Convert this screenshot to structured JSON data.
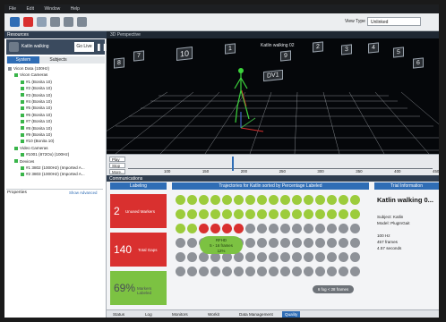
{
  "menu": [
    "File",
    "Edit",
    "Window",
    "Help"
  ],
  "toolbar": {
    "view_type_label": "View Type",
    "view_type_value": "Unlinked"
  },
  "left_panel": {
    "header": "Resources",
    "session_name": "Katlin walking",
    "go_live": "Go Live",
    "tabs": [
      "System",
      "Subjects"
    ],
    "tree": [
      {
        "label": "Vicon Data (100Hz)",
        "indent": 0,
        "color": "grey"
      },
      {
        "label": "Vicon Cameras",
        "indent": 1,
        "color": "green"
      },
      {
        "label": "#1 (Bonita 10)",
        "indent": 2,
        "color": "green"
      },
      {
        "label": "#2 (Bonita 10)",
        "indent": 2,
        "color": "green"
      },
      {
        "label": "#3 (Bonita 10)",
        "indent": 2,
        "color": "green"
      },
      {
        "label": "#4 (Bonita 10)",
        "indent": 2,
        "color": "green"
      },
      {
        "label": "#5 (Bonita 10)",
        "indent": 2,
        "color": "green"
      },
      {
        "label": "#6 (Bonita 10)",
        "indent": 2,
        "color": "green"
      },
      {
        "label": "#7 (Bonita 10)",
        "indent": 2,
        "color": "green"
      },
      {
        "label": "#8 (Bonita 10)",
        "indent": 2,
        "color": "green"
      },
      {
        "label": "#9 (Bonita 10)",
        "indent": 2,
        "color": "green"
      },
      {
        "label": "#10 (Bonita 10)",
        "indent": 2,
        "color": "green"
      },
      {
        "label": "Video Cameras",
        "indent": 1,
        "color": "green"
      },
      {
        "label": "#1001 (872Ox) (100Hz)",
        "indent": 2,
        "color": "green"
      },
      {
        "label": "Devices",
        "indent": 1,
        "color": "green"
      },
      {
        "label": "#1 3802 (1000Hz) (Imported A...",
        "indent": 2,
        "color": "green"
      },
      {
        "label": "#2 3803 (1000Hz) (Imported A...",
        "indent": 2,
        "color": "green"
      }
    ],
    "properties": {
      "title": "Properties",
      "link": "Show Advanced"
    }
  },
  "viewport": {
    "title": "3D Perspective",
    "overlay_label": "Katlin walking 02",
    "camera_labels": [
      "10",
      "1",
      "2",
      "3",
      "4",
      "5",
      "6",
      "7",
      "8",
      "9",
      "DV1"
    ]
  },
  "timeline": {
    "buttons": [
      "Play",
      "Stop",
      "More..."
    ],
    "ticks": [
      "100",
      "150",
      "200",
      "250",
      "300",
      "350",
      "400",
      "450"
    ]
  },
  "communications": {
    "header": "Communications",
    "sections": {
      "labeling": "Labeling",
      "trajectories": "Trajectories for Katlin sorted by Percentage Labeled",
      "trial_info": "Trial Information"
    },
    "tiles": [
      {
        "value": "2",
        "label": "Unused Markers",
        "color": "#d9302f"
      },
      {
        "value": "140",
        "label": "Total Gaps",
        "color": "#d9302f"
      },
      {
        "value": "69%",
        "label": "Markers Labeled",
        "color": "#7cc242"
      }
    ],
    "gap_callout": {
      "name": "RFHD",
      "frames": "5 - 16 frames",
      "pct": "12%"
    },
    "gray_callout": "6 fog < 28 frames",
    "dot_colors": {
      "green": "#9ccc3c",
      "red": "#d9302f",
      "gray": "#8e9298"
    },
    "dot_rows": [
      [
        "green",
        "green",
        "green",
        "green",
        "green",
        "green",
        "green",
        "green",
        "green",
        "green",
        "green",
        "green",
        "green",
        "green",
        "green",
        "green"
      ],
      [
        "green",
        "green",
        "green",
        "green",
        "green",
        "green",
        "green",
        "green",
        "green",
        "green",
        "green",
        "green",
        "green",
        "green",
        "green",
        "green"
      ],
      [
        "green",
        "green",
        "red",
        "red",
        "red",
        "red",
        "gray",
        "gray",
        "gray",
        "gray",
        "gray",
        "gray",
        "gray",
        "gray",
        "gray",
        "gray"
      ],
      [
        "gray",
        "gray",
        "gray",
        "gray",
        "gray",
        "gray",
        "gray",
        "gray",
        "gray",
        "gray",
        "gray",
        "gray",
        "gray",
        "gray",
        "gray",
        "gray"
      ],
      [
        "gray",
        "gray",
        "gray",
        "gray",
        "gray",
        "gray",
        "gray",
        "gray",
        "gray",
        "gray",
        "gray",
        "gray",
        "gray",
        "gray",
        "gray",
        "gray"
      ],
      [
        "gray",
        "gray",
        "gray",
        "gray",
        "gray",
        "gray",
        "gray",
        "gray",
        "gray",
        "gray",
        "gray",
        "gray",
        "gray",
        "gray",
        "gray",
        "gray"
      ]
    ],
    "trial": {
      "title": "Katlin walking 0...",
      "subject": "Subject: Katlin",
      "model": "Model: PlugInGait",
      "stats": [
        "100 Hz",
        "457 frames",
        "4.57 seconds"
      ]
    }
  },
  "bottom_tabs": [
    "Status",
    "Log",
    "Monitors",
    "Workit",
    "Data Management",
    "Quality"
  ],
  "active_bottom_tab": "Quality"
}
